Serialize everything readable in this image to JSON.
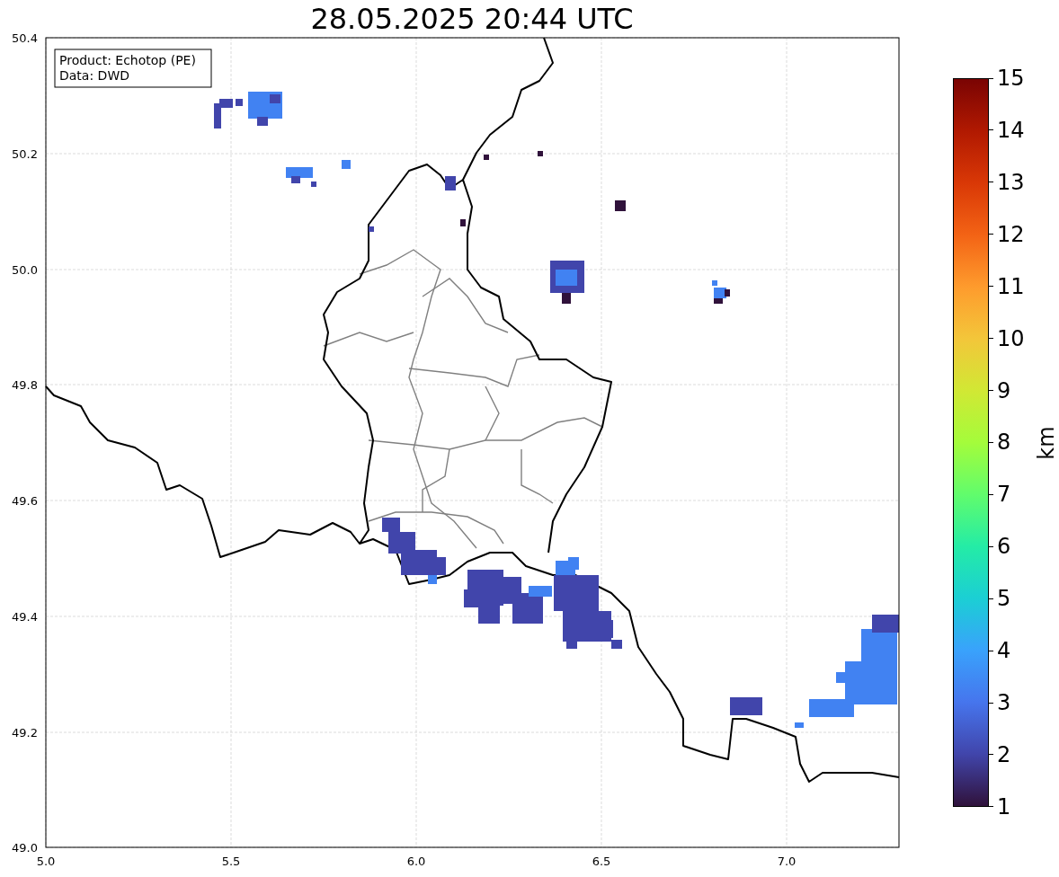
{
  "title": "28.05.2025 20:44 UTC",
  "map": {
    "legend": [
      "Product: Echotop (PE)",
      "Data: DWD"
    ],
    "xticks": [
      "5.0",
      "5.5",
      "6.0",
      "6.5",
      "7.0"
    ],
    "yticks": [
      "50.4",
      "50.2",
      "50.0",
      "49.8",
      "49.6",
      "49.4",
      "49.2",
      "49.0"
    ]
  },
  "colorbar": {
    "label": "km",
    "ticks": [
      "15",
      "14",
      "13",
      "12",
      "11",
      "10",
      "9",
      "8",
      "7",
      "6",
      "5",
      "4",
      "3",
      "2",
      "1"
    ]
  }
}
